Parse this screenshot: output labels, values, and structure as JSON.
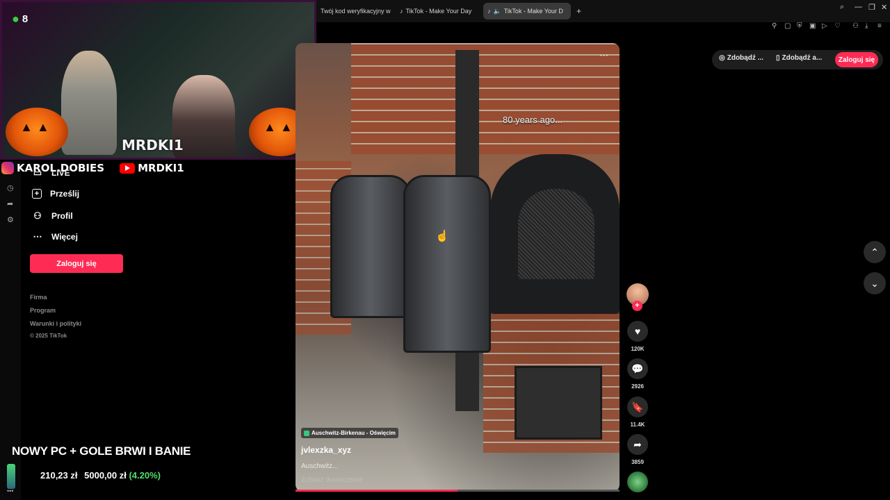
{
  "browser": {
    "tabs": [
      {
        "label": "Twój kod weryfikacyjny w"
      },
      {
        "label": "TikTok - Make Your Day"
      },
      {
        "label": "TikTok - Make Your D"
      }
    ],
    "new_tab": "+"
  },
  "stream_overlay": {
    "viewer_count": "8",
    "streamer_name": "MRDKI1",
    "instagram_handle": "KAROL.DOBIES",
    "youtube_handle": "MRDKI1",
    "goal_title": "NOWY PC + GOLE BRWI I BANIE",
    "goal_current": "210,23 zł",
    "goal_target": "5000,00 zł",
    "goal_percent": "(4.20%)"
  },
  "sidebar": {
    "items": [
      {
        "label": "LIVE",
        "icon": "live-icon"
      },
      {
        "label": "Prześlij",
        "icon": "upload-icon"
      },
      {
        "label": "Profil",
        "icon": "profile-icon"
      },
      {
        "label": "Więcej",
        "icon": "more-icon"
      }
    ],
    "login_label": "Zaloguj się",
    "footer": [
      "Firma",
      "Program",
      "Warunki i polityki",
      "© 2025 TikTok"
    ]
  },
  "video": {
    "caption_overlay": "80 years ago...",
    "location": "Auschwitz-Birkenau - Oświęcim",
    "author": "jvlexzka_xyz",
    "description": "Auschwitz...",
    "translate_label": "Zobacz tłumaczenie",
    "progress": 0.5
  },
  "actions": {
    "likes": "120K",
    "comments": "2926",
    "saves": "11.4K",
    "shares": "3859"
  },
  "header": {
    "pill1": "Zdobądź ...",
    "pill2": "Zdobądź a...",
    "login_label": "Zaloguj się"
  },
  "colors": {
    "accent": "#fe2c55",
    "goal_percent": "#4fe06e"
  }
}
